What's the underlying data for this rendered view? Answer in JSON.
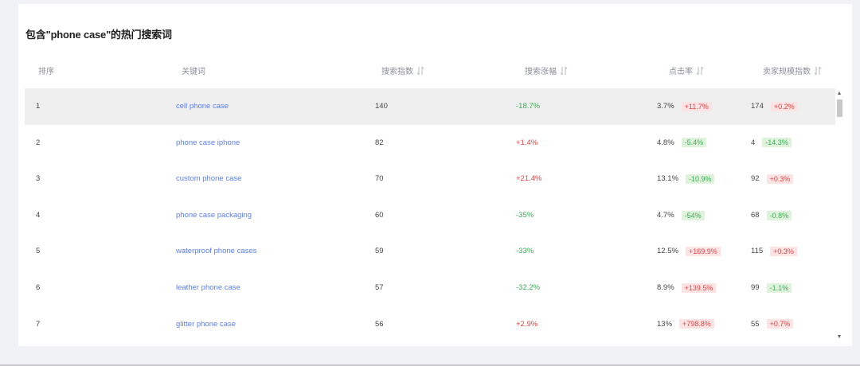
{
  "title": "包含\"phone case\"的热门搜索词",
  "headers": {
    "rank": "排序",
    "keyword": "关键词",
    "search_index": "搜索指数",
    "search_growth": "搜索涨幅",
    "ctr": "点击率",
    "seller_scale": "卖家规模指数"
  },
  "rows": [
    {
      "rank": "1",
      "keyword": "cell phone case",
      "search_index": "140",
      "search_growth": "-18.7%",
      "ctr": "3.7%",
      "ctr_change": "+11.7%",
      "seller": "174",
      "seller_change": "+0.2%"
    },
    {
      "rank": "2",
      "keyword": "phone case iphone",
      "search_index": "82",
      "search_growth": "+1.4%",
      "ctr": "4.8%",
      "ctr_change": "-5.4%",
      "seller": "4",
      "seller_change": "-14.3%"
    },
    {
      "rank": "3",
      "keyword": "custom phone case",
      "search_index": "70",
      "search_growth": "+21.4%",
      "ctr": "13.1%",
      "ctr_change": "-10.9%",
      "seller": "92",
      "seller_change": "+0.3%"
    },
    {
      "rank": "4",
      "keyword": "phone case packaging",
      "search_index": "60",
      "search_growth": "-35%",
      "ctr": "4.7%",
      "ctr_change": "-54%",
      "seller": "68",
      "seller_change": "-0.8%"
    },
    {
      "rank": "5",
      "keyword": "waterproof phone cases",
      "search_index": "59",
      "search_growth": "-33%",
      "ctr": "12.5%",
      "ctr_change": "+169.9%",
      "seller": "115",
      "seller_change": "+0.3%"
    },
    {
      "rank": "6",
      "keyword": "leather phone case",
      "search_index": "57",
      "search_growth": "-32.2%",
      "ctr": "8.9%",
      "ctr_change": "+139.5%",
      "seller": "99",
      "seller_change": "-1.1%"
    },
    {
      "rank": "7",
      "keyword": "glitter phone case",
      "search_index": "56",
      "search_growth": "+2.9%",
      "ctr": "13%",
      "ctr_change": "+798.8%",
      "seller": "55",
      "seller_change": "+0.7%"
    }
  ],
  "colors": {
    "positive": "#e04444",
    "negative": "#3dac56",
    "link": "#5b7ff2"
  },
  "icons": {
    "sort": "sort-icon",
    "scroll_up": "scroll-up-arrow-icon",
    "scroll_down": "scroll-down-arrow-icon"
  }
}
